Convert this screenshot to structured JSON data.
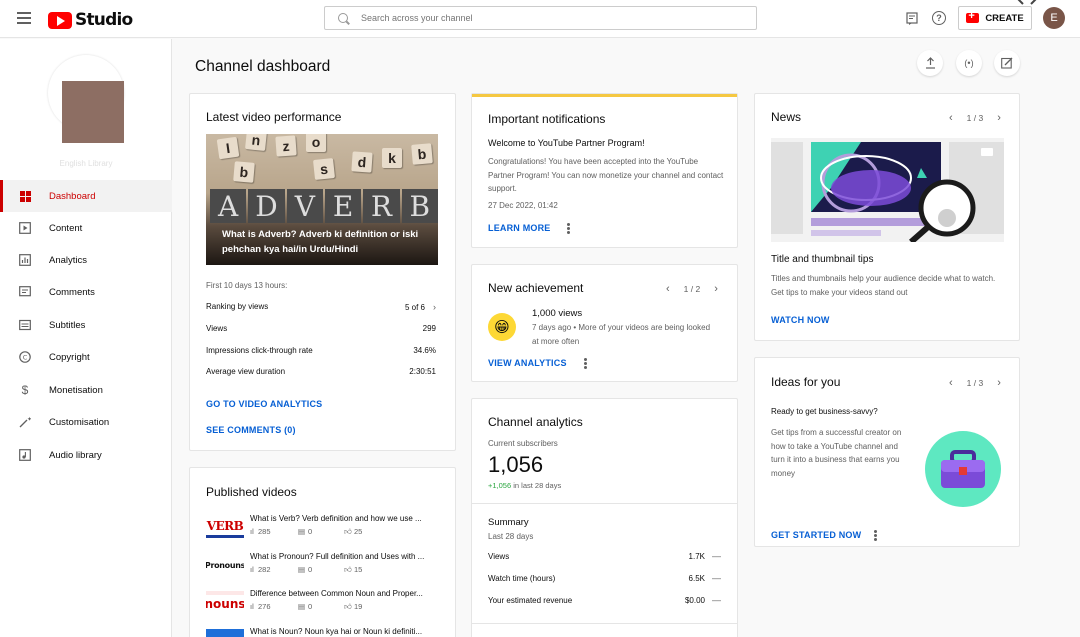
{
  "header": {
    "app_name": "Studio",
    "search_placeholder": "Search across your channel",
    "create_label": "CREATE",
    "avatar_letter": "E"
  },
  "sidebar": {
    "channel_name": "English Library",
    "items": [
      {
        "label": "Dashboard",
        "icon": "dashboard-icon"
      },
      {
        "label": "Content",
        "icon": "content-icon"
      },
      {
        "label": "Analytics",
        "icon": "analytics-icon"
      },
      {
        "label": "Comments",
        "icon": "comments-icon"
      },
      {
        "label": "Subtitles",
        "icon": "subtitles-icon"
      },
      {
        "label": "Copyright",
        "icon": "copyright-icon"
      },
      {
        "label": "Monetisation",
        "icon": "monetisation-icon"
      },
      {
        "label": "Customisation",
        "icon": "customisation-icon"
      },
      {
        "label": "Audio library",
        "icon": "audio-library-icon"
      }
    ]
  },
  "page": {
    "title": "Channel dashboard"
  },
  "latest_video": {
    "title": "Latest video performance",
    "thumb_caption": "What is Adverb? Adverb ki definition or iski pehchan kya hai/in Urdu/Hindi",
    "thumb_word": "ADVERB",
    "period": "First 10 days 13 hours:",
    "stats": [
      {
        "label": "Ranking by views",
        "value": "5 of 6"
      },
      {
        "label": "Views",
        "value": "299"
      },
      {
        "label": "Impressions click-through rate",
        "value": "34.6%"
      },
      {
        "label": "Average view duration",
        "value": "2:30:51"
      }
    ],
    "link_analytics": "GO TO VIDEO ANALYTICS",
    "link_comments": "SEE COMMENTS (0)"
  },
  "published": {
    "title": "Published videos",
    "videos": [
      {
        "thumb": "VERB",
        "title": "What is Verb? Verb definition and how we use ...",
        "views": "285",
        "comments": "0",
        "likes": "25"
      },
      {
        "thumb": "Pronouns",
        "title": "What is Pronoun? Full definition and Uses with ...",
        "views": "282",
        "comments": "0",
        "likes": "15"
      },
      {
        "thumb": "nouns",
        "title": "Difference between Common Noun and Proper...",
        "views": "276",
        "comments": "0",
        "likes": "19"
      },
      {
        "thumb": "",
        "title": "What is Noun? Noun kya hai or Noun ki definiti...",
        "views": "",
        "comments": "",
        "likes": ""
      }
    ]
  },
  "notifications": {
    "title": "Important notifications",
    "heading": "Welcome to YouTube Partner Program!",
    "body": "Congratulations! You have been accepted into the YouTube Partner Program! You can now monetize your channel and contact support.",
    "date": "27 Dec 2022, 01:42",
    "link": "LEARN MORE"
  },
  "achievement": {
    "title": "New achievement",
    "pager": "1 / 2",
    "milestone": "1,000 views",
    "detail": "7 days ago • More of your videos are being looked at more often",
    "link": "VIEW ANALYTICS"
  },
  "channel_analytics": {
    "title": "Channel analytics",
    "subs_label": "Current subscribers",
    "subs_value": "1,056",
    "subs_change": "+1,056",
    "subs_change_suffix": "in last 28 days",
    "summary_title": "Summary",
    "summary_period": "Last 28 days",
    "rows": [
      {
        "label": "Views",
        "value": "1.7K",
        "delta": "—"
      },
      {
        "label": "Watch time (hours)",
        "value": "6.5K",
        "delta": "—"
      },
      {
        "label": "Your estimated revenue",
        "value": "$0.00",
        "delta": "—"
      }
    ]
  },
  "news": {
    "title": "News",
    "pager": "1 / 3",
    "headline": "Title and thumbnail tips",
    "body": "Titles and thumbnails help your audience decide what to watch. Get tips to make your videos stand out",
    "link": "WATCH NOW"
  },
  "ideas": {
    "title": "Ideas for you",
    "pager": "1 / 3",
    "heading": "Ready to get business-savvy?",
    "body": "Get tips from a successful creator on how to take a YouTube channel and turn it into a business that earns you money",
    "link": "GET STARTED NOW"
  },
  "colors": {
    "brand_red": "#ff0000",
    "active_red": "#cc0000",
    "link_blue": "#065fd4",
    "positive_green": "#2ba640",
    "notification_accent": "#f5c842",
    "ideas_circle": "#5ee8c1",
    "ideas_briefcase": "#7b4bd8"
  }
}
